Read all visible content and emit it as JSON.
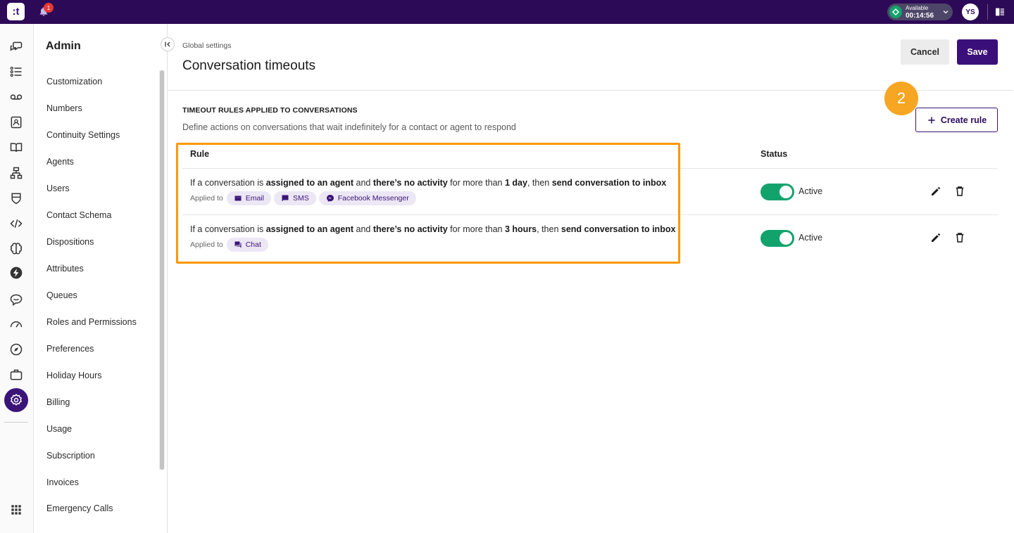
{
  "topbar": {
    "logo_text": ":t",
    "notification_count": "1",
    "status_label": "Available",
    "status_timer": "00:14:56",
    "avatar_initials": "YS"
  },
  "sidebar": {
    "title": "Admin",
    "items": [
      {
        "label": "Customization"
      },
      {
        "label": "Numbers"
      },
      {
        "label": "Continuity Settings"
      },
      {
        "label": "Agents"
      },
      {
        "label": "Users"
      },
      {
        "label": "Contact Schema"
      },
      {
        "label": "Dispositions"
      },
      {
        "label": "Attributes"
      },
      {
        "label": "Queues"
      },
      {
        "label": "Roles and Permissions"
      },
      {
        "label": "Preferences"
      },
      {
        "label": "Holiday Hours"
      },
      {
        "label": "Billing"
      },
      {
        "label": "Usage"
      },
      {
        "label": "Subscription"
      },
      {
        "label": "Invoices"
      },
      {
        "label": "Emergency Calls"
      }
    ]
  },
  "header": {
    "breadcrumb": "Global settings",
    "title": "Conversation timeouts",
    "cancel_label": "Cancel",
    "save_label": "Save"
  },
  "section": {
    "title": "TIMEOUT RULES APPLIED TO CONVERSATIONS",
    "description": "Define actions on conversations that wait indefinitely for a contact or agent to respond",
    "create_label": "Create rule",
    "step_marker": "2"
  },
  "table": {
    "col_rule": "Rule",
    "col_status": "Status",
    "applied_to_label": "Applied to",
    "rows": [
      {
        "t1": "If a conversation is ",
        "b1": "assigned to an agent",
        "t2": " and ",
        "b2": "there’s no activity",
        "t3": " for more than ",
        "b3": "1 day",
        "t4": ", then ",
        "b4": "send conversation to inbox",
        "channels": [
          "Email",
          "SMS",
          "Facebook Messenger"
        ],
        "status": "Active"
      },
      {
        "t1": "If a conversation is ",
        "b1": "assigned to an agent",
        "t2": " and ",
        "b2": "there’s no activity",
        "t3": " for more than ",
        "b3": "3 hours",
        "t4": ", then ",
        "b4": "send conversation to inbox",
        "channels": [
          "Chat"
        ],
        "status": "Active"
      }
    ]
  },
  "colors": {
    "brand": "#2d0a57",
    "primary_button": "#3b0f7a",
    "toggle_on": "#12a36c",
    "highlight": "#ff9800",
    "step_marker": "#f6a623"
  }
}
